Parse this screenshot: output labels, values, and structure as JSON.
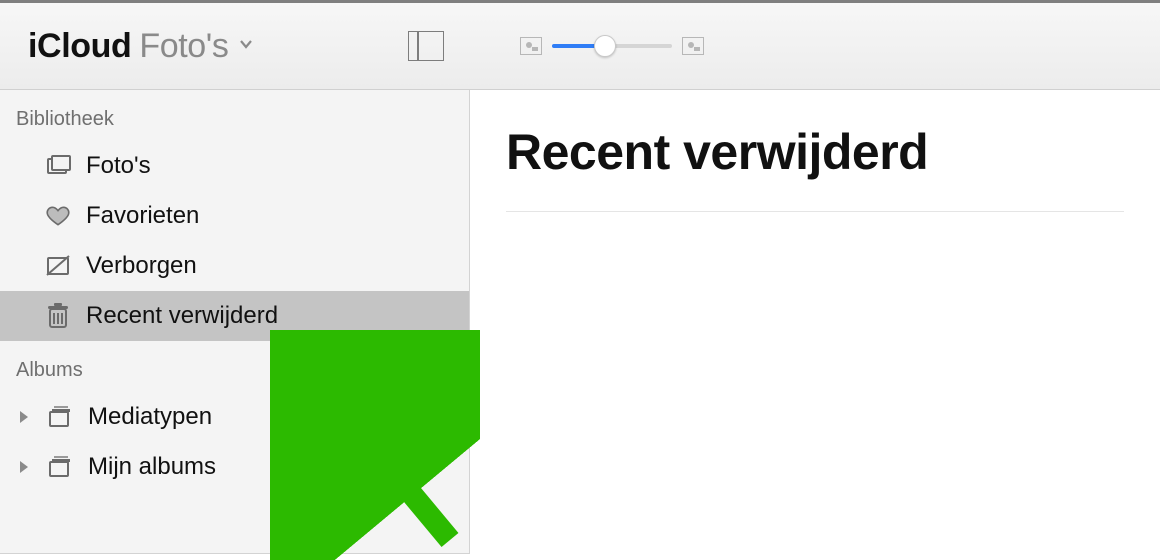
{
  "header": {
    "app_title_word1": "iCloud",
    "app_title_word2": "Foto's"
  },
  "slider": {
    "value_percent": 44
  },
  "sidebar": {
    "sections": [
      {
        "label": "Bibliotheek",
        "items": [
          {
            "icon": "photos-icon",
            "label": "Foto's",
            "selected": false
          },
          {
            "icon": "heart-icon",
            "label": "Favorieten",
            "selected": false
          },
          {
            "icon": "hidden-icon",
            "label": "Verborgen",
            "selected": false
          },
          {
            "icon": "trash-icon",
            "label": "Recent verwijderd",
            "selected": true
          }
        ]
      },
      {
        "label": "Albums",
        "items": [
          {
            "icon": "stack-icon",
            "label": "Mediatypen",
            "disclosure": true
          },
          {
            "icon": "stack-icon",
            "label": "Mijn albums",
            "disclosure": true
          }
        ]
      }
    ]
  },
  "content": {
    "title": "Recent verwijderd"
  },
  "annotation": {
    "arrow_color": "#2cba00"
  }
}
